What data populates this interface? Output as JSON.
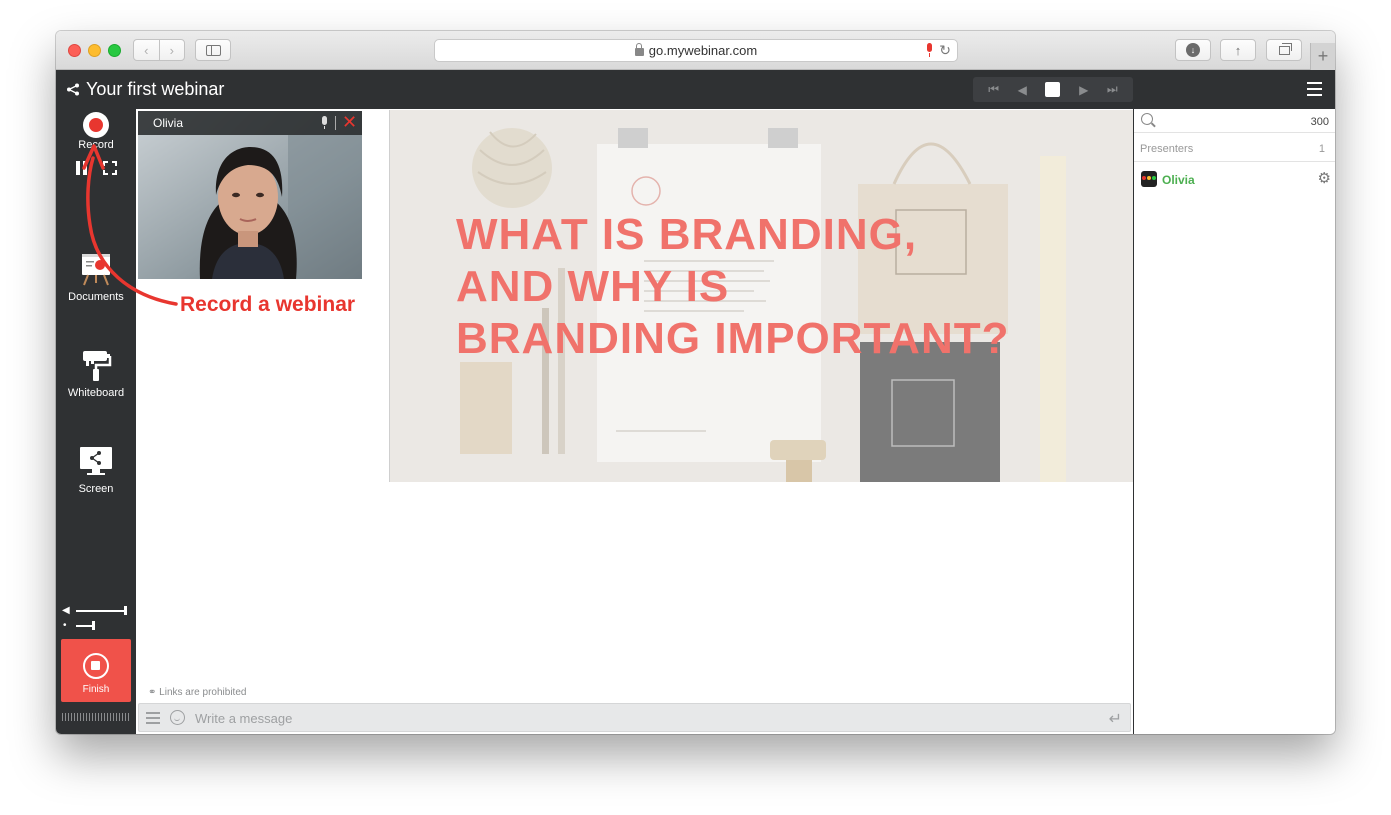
{
  "browser": {
    "url": "go.mywebinar.com",
    "icons": [
      "back-icon",
      "forward-icon",
      "sidebar-icon",
      "lock-icon",
      "microphone-icon",
      "reload-icon",
      "download-icon",
      "share-icon",
      "tabs-icon",
      "new-tab-icon"
    ]
  },
  "header": {
    "title": "Your first webinar",
    "icons": [
      "share-icon",
      "first-slide-icon",
      "prev-slide-icon",
      "stop-icon",
      "next-slide-icon",
      "last-slide-icon",
      "menu-icon"
    ]
  },
  "toolbar": {
    "record_label": "Record",
    "documents_label": "Documents",
    "whiteboard_label": "Whiteboard",
    "screen_label": "Screen",
    "finish_label": "Finish"
  },
  "camera": {
    "presenter_name": "Olivia"
  },
  "slide": {
    "line1": "WHAT IS BRANDING,",
    "line2": "AND WHY IS",
    "line3": "BRANDING IMPORTANT?"
  },
  "chat": {
    "links_note": "Links are prohibited",
    "placeholder": "Write a message"
  },
  "participants": {
    "count": "300",
    "section_label": "Presenters",
    "section_count": "1",
    "users": [
      {
        "name": "Olivia"
      }
    ]
  },
  "annotation": {
    "text": "Record a webinar",
    "color": "#e8362f"
  },
  "colors": {
    "accent": "#e8362f",
    "finish": "#f0524a",
    "app_dark": "#2f3133",
    "presenter": "#4caf50"
  }
}
